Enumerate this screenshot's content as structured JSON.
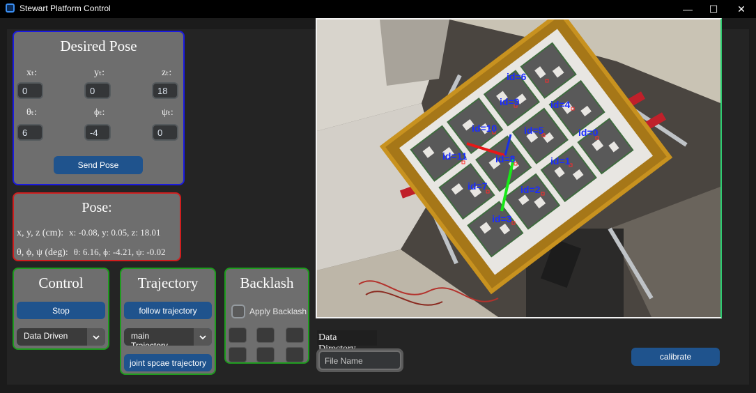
{
  "window": {
    "title": "Stewart Platform Control",
    "minimize": "—",
    "maximize": "☐",
    "close": "✕"
  },
  "desired_pose": {
    "title": "Desired Pose",
    "labels": {
      "x": "xₜ:",
      "y": "yₜ:",
      "z": "zₜ:",
      "theta": "θₜ:",
      "phi": "ϕₜ:",
      "psi": "ψₜ:"
    },
    "values": {
      "x": "0",
      "y": "0",
      "z": "18",
      "theta": "6",
      "phi": "-4",
      "psi": "0"
    },
    "send_button": "Send Pose"
  },
  "pose": {
    "title": "Pose:",
    "position_label": "x, y, z (cm):",
    "position_value": "x: -0.08, y: 0.05, z: 18.01",
    "angles_label": "θ, ϕ, ψ (deg):",
    "angles_value": "θ: 6.16, ϕ: -4.21, ψ: -0.02"
  },
  "control": {
    "title": "Control",
    "stop_button": "Stop",
    "mode_select": "Data Driven"
  },
  "trajectory": {
    "title": "Trajectory",
    "follow_button": "follow trajectory",
    "trajectory_select": "main Trajectory",
    "joint_button": "joint spcae trajectory"
  },
  "backlash": {
    "title": "Backlash",
    "apply_label": "Apply Backlash",
    "apply_checked": false
  },
  "data_directory": {
    "label": "Data Directory",
    "file_name_placeholder": "File Name"
  },
  "calibrate_button": "calibrate",
  "camera": {
    "marker_ids": [
      "id=6",
      "id=9",
      "id=4",
      "id=10",
      "id=5",
      "id=0",
      "id=11",
      "id=8",
      "id=1",
      "id=7",
      "id=2",
      "id=3"
    ]
  },
  "colors": {
    "accent_button": "#1f538d",
    "desired_pose_border": "#1a1ae0",
    "pose_border": "#d01e1e",
    "group_border": "#1e9c1e",
    "directory_border": "#5a5a5a",
    "marker_label": "#1a2cff"
  }
}
